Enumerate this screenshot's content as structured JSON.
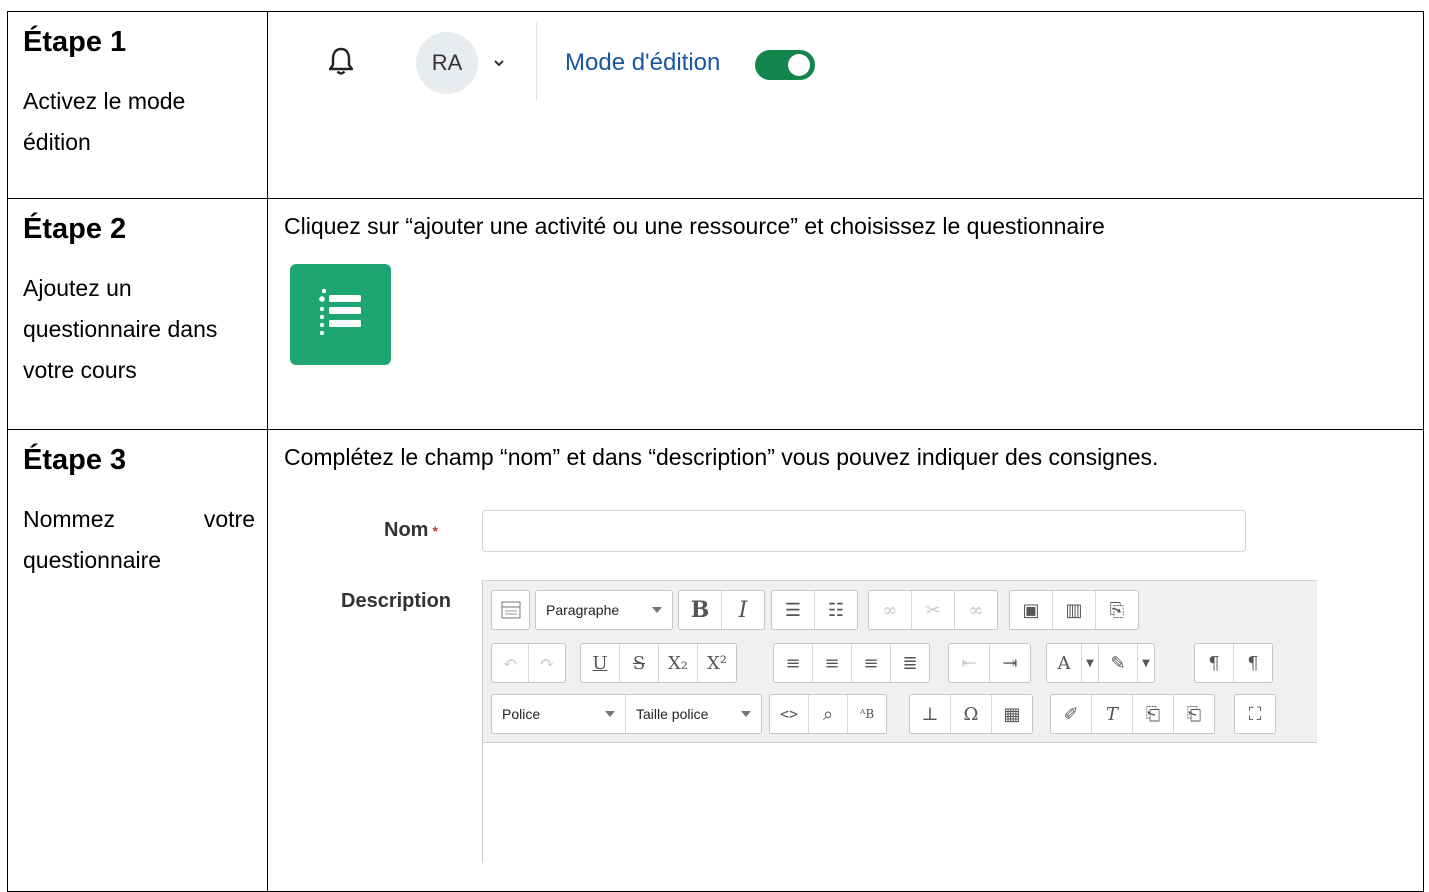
{
  "steps": [
    {
      "title": "Étape 1",
      "description": [
        "Activez le mode",
        "édition"
      ],
      "header": {
        "avatar_initials": "RA",
        "edit_mode_label": "Mode d'édition",
        "edit_mode_on": true
      }
    },
    {
      "title": "Étape 2",
      "description": [
        "Ajoutez un",
        "questionnaire dans",
        "votre cours"
      ],
      "instruction": "Cliquez sur “ajouter une activité ou une ressource” et choisissez le questionnaire",
      "icon": "quiz-list-icon",
      "icon_color": "#1da671"
    },
    {
      "title": "Étape 3",
      "description": [
        "Nommez votre",
        "questionnaire"
      ],
      "instruction": "Complétez le champ “nom” et dans “description” vous pouvez indiquer des consignes.",
      "form": {
        "name_label": "Nom",
        "required_mark": "*",
        "description_label": "Description",
        "editor": {
          "paragraph_select": "Paragraphe",
          "font_select": "Police",
          "font_size_select": "Taille police"
        }
      }
    }
  ],
  "colors": {
    "toggle_on": "#15854e",
    "mode_label": "#1a56a0",
    "required": "#c0392b"
  }
}
